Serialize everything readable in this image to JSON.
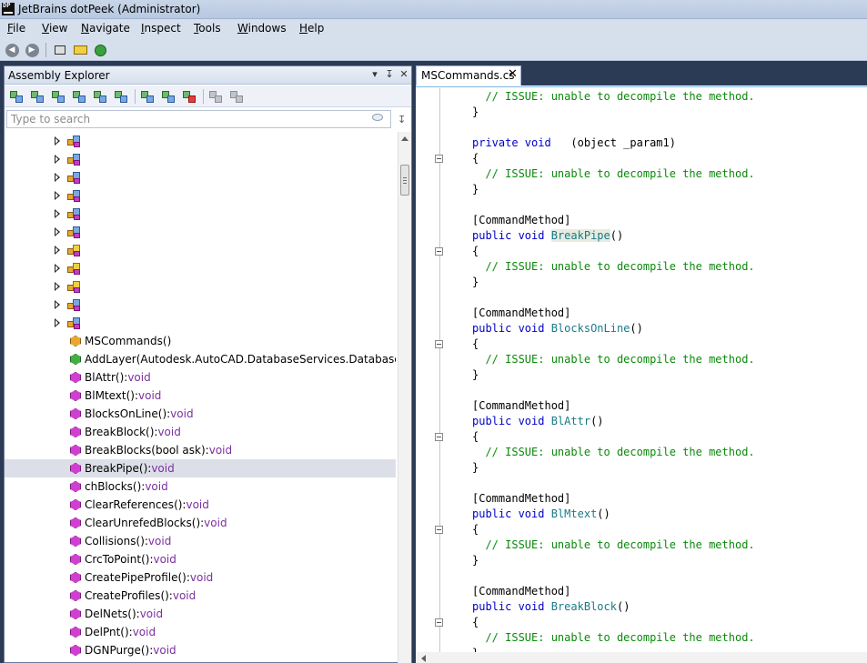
{
  "window": {
    "title": "JetBrains dotPeek (Administrator)",
    "icon_text": "DP"
  },
  "menu": [
    "File",
    "View",
    "Navigate",
    "Inspect",
    "Tools",
    "Windows",
    "Help"
  ],
  "menu_mnemonics": [
    "F",
    "V",
    "N",
    "I",
    "T",
    "W",
    "H"
  ],
  "toolbar": {
    "back_icon": "back-arrow-icon",
    "forward_icon": "forward-arrow-icon"
  },
  "assembly_explorer": {
    "title": "Assembly Explorer",
    "search_placeholder": "Type to search",
    "tree": [
      {
        "kind": "namespace",
        "label": ""
      },
      {
        "kind": "namespace",
        "label": ""
      },
      {
        "kind": "namespace",
        "label": ""
      },
      {
        "kind": "namespace",
        "label": ""
      },
      {
        "kind": "namespace",
        "label": ""
      },
      {
        "kind": "namespace",
        "label": ""
      },
      {
        "kind": "namespace-alt",
        "label": ""
      },
      {
        "kind": "namespace-alt",
        "label": ""
      },
      {
        "kind": "namespace-alt",
        "label": ""
      },
      {
        "kind": "namespace",
        "label": ""
      },
      {
        "kind": "namespace",
        "label": ""
      },
      {
        "kind": "ctor",
        "label": "MSCommands()",
        "ret": ""
      },
      {
        "kind": "ext",
        "label": "AddLayer(Autodesk.AutoCAD.DatabaseServices.Database db, strin",
        "ret": ""
      },
      {
        "kind": "method",
        "label": "BlAttr():",
        "ret": "void"
      },
      {
        "kind": "method",
        "label": "BlMtext():",
        "ret": "void"
      },
      {
        "kind": "method",
        "label": "BlocksOnLine():",
        "ret": "void"
      },
      {
        "kind": "method",
        "label": "BreakBlock():",
        "ret": "void"
      },
      {
        "kind": "method",
        "label": "BreakBlocks(bool ask):",
        "ret": "void"
      },
      {
        "kind": "method",
        "label": "BreakPipe():",
        "ret": "void",
        "selected": true
      },
      {
        "kind": "method",
        "label": "chBlocks():",
        "ret": "void"
      },
      {
        "kind": "method",
        "label": "ClearReferences():",
        "ret": "void"
      },
      {
        "kind": "method",
        "label": "ClearUnrefedBlocks():",
        "ret": "void"
      },
      {
        "kind": "method",
        "label": "Collisions():",
        "ret": "void"
      },
      {
        "kind": "method",
        "label": "CrcToPoint():",
        "ret": "void"
      },
      {
        "kind": "method",
        "label": "CreatePipeProfile():",
        "ret": "void"
      },
      {
        "kind": "method",
        "label": "CreateProfiles():",
        "ret": "void"
      },
      {
        "kind": "method",
        "label": "DelNets():",
        "ret": "void"
      },
      {
        "kind": "method",
        "label": "DelPnt():",
        "ret": "void"
      },
      {
        "kind": "method",
        "label": "DGNPurge():",
        "ret": "void"
      }
    ]
  },
  "editor": {
    "tab_title": "MSCommands.cs",
    "tab_close": "✕",
    "code": [
      {
        "kind": "comment",
        "text": "  // ISSUE: unable to decompile the method."
      },
      {
        "kind": "plain",
        "text": "}"
      },
      {
        "kind": "blank",
        "text": ""
      },
      {
        "kind": "decl",
        "kw": "private void",
        "rest": "  (object _param1)",
        "fn": ""
      },
      {
        "kind": "plain",
        "text": "{"
      },
      {
        "kind": "comment",
        "text": "  // ISSUE: unable to decompile the method."
      },
      {
        "kind": "plain",
        "text": "}"
      },
      {
        "kind": "blank",
        "text": ""
      },
      {
        "kind": "plain",
        "text": "[CommandMethod]"
      },
      {
        "kind": "decl",
        "kw": "public void",
        "fn": "BreakPipe",
        "rest": "()",
        "highlight": true
      },
      {
        "kind": "plain",
        "text": "{"
      },
      {
        "kind": "comment",
        "text": "  // ISSUE: unable to decompile the method."
      },
      {
        "kind": "plain",
        "text": "}"
      },
      {
        "kind": "blank",
        "text": ""
      },
      {
        "kind": "plain",
        "text": "[CommandMethod]"
      },
      {
        "kind": "decl",
        "kw": "public void",
        "fn": "BlocksOnLine",
        "rest": "()"
      },
      {
        "kind": "plain",
        "text": "{"
      },
      {
        "kind": "comment",
        "text": "  // ISSUE: unable to decompile the method."
      },
      {
        "kind": "plain",
        "text": "}"
      },
      {
        "kind": "blank",
        "text": ""
      },
      {
        "kind": "plain",
        "text": "[CommandMethod]"
      },
      {
        "kind": "decl",
        "kw": "public void",
        "fn": "BlAttr",
        "rest": "()"
      },
      {
        "kind": "plain",
        "text": "{"
      },
      {
        "kind": "comment",
        "text": "  // ISSUE: unable to decompile the method."
      },
      {
        "kind": "plain",
        "text": "}"
      },
      {
        "kind": "blank",
        "text": ""
      },
      {
        "kind": "plain",
        "text": "[CommandMethod]"
      },
      {
        "kind": "decl",
        "kw": "public void",
        "fn": "BlMtext",
        "rest": "()"
      },
      {
        "kind": "plain",
        "text": "{"
      },
      {
        "kind": "comment",
        "text": "  // ISSUE: unable to decompile the method."
      },
      {
        "kind": "plain",
        "text": "}"
      },
      {
        "kind": "blank",
        "text": ""
      },
      {
        "kind": "plain",
        "text": "[CommandMethod]"
      },
      {
        "kind": "decl",
        "kw": "public void",
        "fn": "BreakBlock",
        "rest": "()"
      },
      {
        "kind": "plain",
        "text": "{"
      },
      {
        "kind": "comment",
        "text": "  // ISSUE: unable to decompile the method."
      },
      {
        "kind": "plain",
        "text": "}"
      }
    ]
  }
}
